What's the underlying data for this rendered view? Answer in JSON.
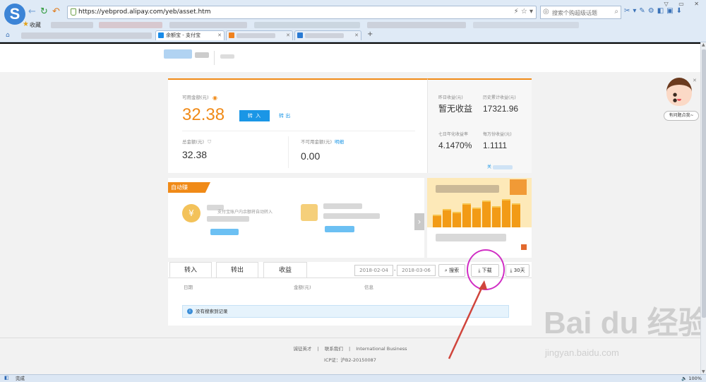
{
  "browser": {
    "url": "https://yebprod.alipay.com/yeb/asset.htm",
    "search_placeholder": "搜索个购超级话题",
    "favorites_label": "收藏",
    "tabs": [
      {
        "label": "余额宝 - 支付宝",
        "active": true
      },
      {
        "label": "",
        "active": false
      },
      {
        "label": "",
        "active": false
      }
    ],
    "status_text": "完成",
    "zoom": "100%"
  },
  "asset": {
    "available_label": "可用金额(元)",
    "available_value": "32.38",
    "transfer_in_label": "转 入",
    "transfer_out_label": "转 出",
    "total_label": "总金额(元)",
    "total_value": "32.38",
    "unavailable_label": "不可用金额(元)",
    "unavailable_link": "明细",
    "unavailable_value": "0.00"
  },
  "earnings": {
    "yesterday_label": "昨日收益(元)",
    "yesterday_value": "暂无收益",
    "cumulative_label": "历史累计收益(元)",
    "cumulative_value": "17321.96",
    "seven_day_label": "七日年化收益率",
    "seven_day_value": "4.1470%",
    "per_10k_label": "每万份收益(元)",
    "per_10k_value": "1.1111",
    "more_link": "关"
  },
  "auto": {
    "tag_label": "自动赚",
    "desc": "支付宝账户内余额将自动转入"
  },
  "records": {
    "tabs": [
      "转入",
      "转出",
      "收益"
    ],
    "start_date": "2018-02-04",
    "end_date": "2018-03-06",
    "date_separator": "-",
    "search_label": "搜索",
    "download_label": "下载",
    "days_label": "30天",
    "columns": [
      "日期",
      "金额(元)",
      "信息"
    ],
    "empty_notice": "没有搜索到记录"
  },
  "footer": {
    "links": [
      "诚征英才",
      "|",
      "联系我们",
      "|",
      "International Business"
    ],
    "icp": "ICP证：沪B2-20150087"
  },
  "helper": {
    "label": "有问题点我~"
  },
  "watermark": {
    "big": "Bai du 经验",
    "small": "jingyan.baidu.com"
  },
  "colors": {
    "accent_orange": "#f08a17",
    "accent_blue": "#1a96e6",
    "annotation_magenta": "#d02ec4"
  }
}
